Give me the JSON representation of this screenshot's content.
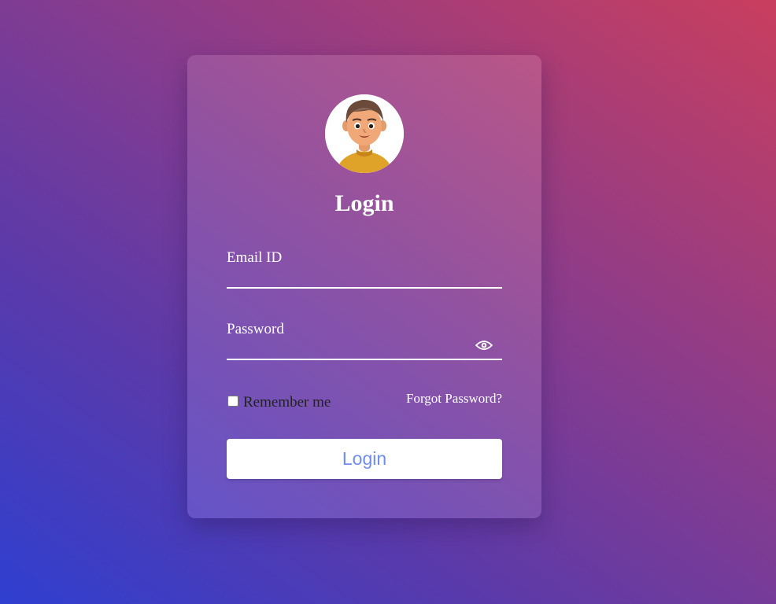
{
  "form": {
    "title": "Login",
    "email_label": "Email ID",
    "email_value": "",
    "password_label": "Password",
    "password_value": "",
    "remember_label": "Remember me",
    "remember_checked": false,
    "forgot_link": "Forgot Password?",
    "submit_label": "Login"
  },
  "icons": {
    "avatar": "user-avatar-icon",
    "password_toggle": "eye-icon"
  },
  "colors": {
    "button_text": "#6f8cf0",
    "gradient_start": "#2f3fd0",
    "gradient_end": "#c93e5e"
  }
}
